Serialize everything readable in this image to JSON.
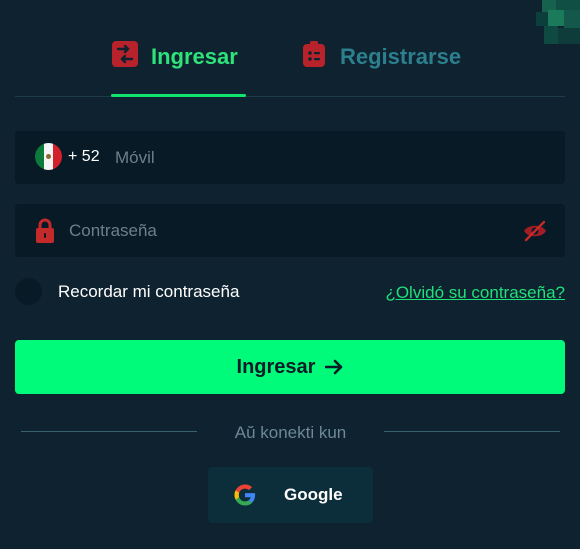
{
  "tabs": {
    "login": "Ingresar",
    "register": "Registrarse"
  },
  "phone": {
    "country_code": "+ 52",
    "placeholder": "Móvil",
    "flag": "mexico-flag-icon"
  },
  "password": {
    "placeholder": "Contraseña"
  },
  "remember_label": "Recordar mi contraseña",
  "forgot_label": "¿Olvidó su contraseña?",
  "submit_label": "Ingresar",
  "divider_text": "Aŭ konekti kun",
  "social": {
    "google_label": "Google"
  },
  "icons": {
    "login_tab": "login-arrows-icon",
    "register_tab": "clipboard-icon",
    "password": "lock-icon",
    "visibility": "eye-off-icon",
    "submit": "arrow-right-icon",
    "google": "google-icon"
  },
  "colors": {
    "background": "#0e2230",
    "field_background": "#071a26",
    "accent": "#00fa7a",
    "active_tab": "#2ee37a",
    "inactive_tab": "#2c7f8c",
    "icon_red": "#c42a2a"
  }
}
